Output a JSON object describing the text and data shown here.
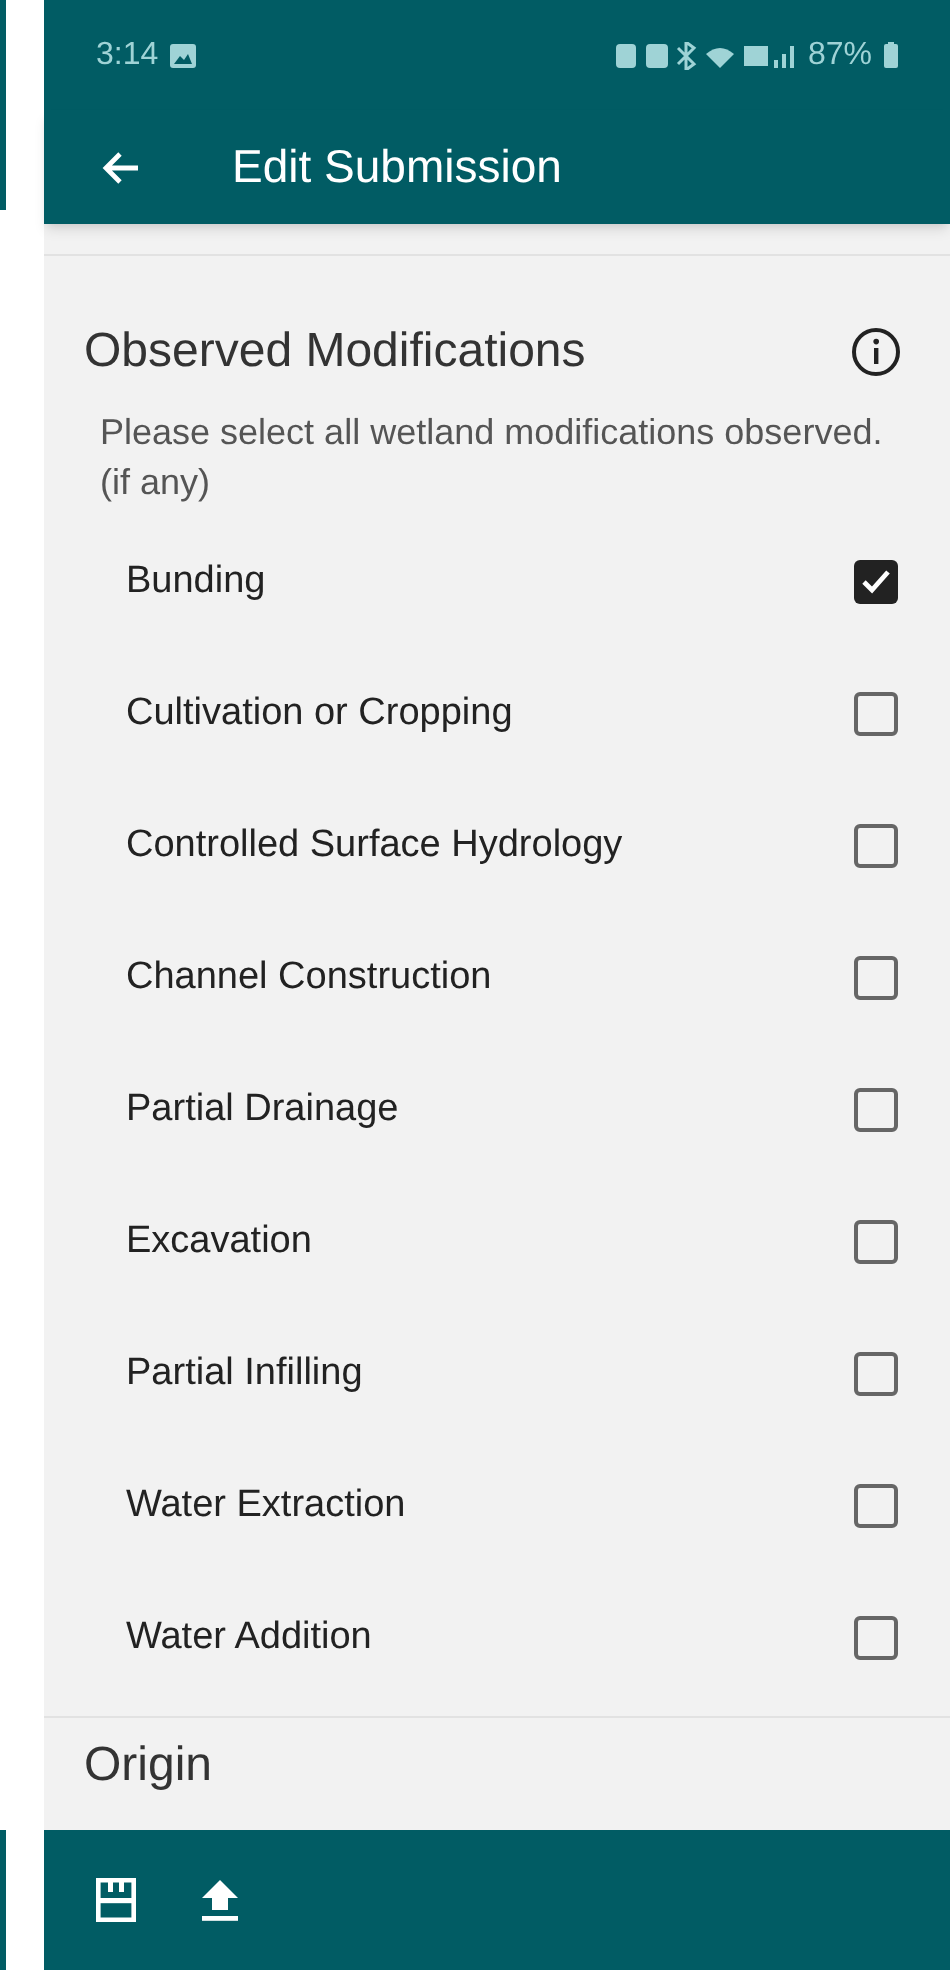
{
  "status_bar": {
    "time": "3:14",
    "battery": "87%"
  },
  "app_bar": {
    "title": "Edit Submission"
  },
  "section": {
    "title": "Observed Modifications",
    "description": "Please select all wetland modifications observed. (if any)",
    "options": [
      {
        "label": "Bunding",
        "checked": true
      },
      {
        "label": "Cultivation or Cropping",
        "checked": false
      },
      {
        "label": "Controlled Surface Hydrology",
        "checked": false
      },
      {
        "label": "Channel Construction",
        "checked": false
      },
      {
        "label": "Partial Drainage",
        "checked": false
      },
      {
        "label": "Excavation",
        "checked": false
      },
      {
        "label": "Partial Infilling",
        "checked": false
      },
      {
        "label": "Water Extraction",
        "checked": false
      },
      {
        "label": "Water Addition",
        "checked": false
      }
    ]
  },
  "next_section": {
    "title": "Origin"
  }
}
